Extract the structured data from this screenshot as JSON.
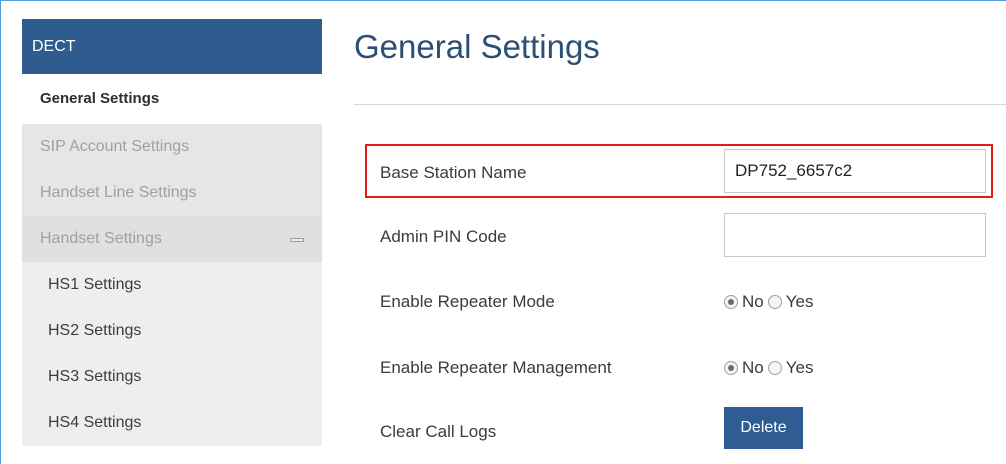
{
  "sidebar": {
    "header": "DECT",
    "active_item": "General Settings",
    "items": [
      {
        "label": "SIP Account Settings"
      },
      {
        "label": "Handset Line Settings"
      },
      {
        "label": "Handset Settings"
      }
    ],
    "sub_items": [
      {
        "label": "HS1 Settings"
      },
      {
        "label": "HS2 Settings"
      },
      {
        "label": "HS3 Settings"
      },
      {
        "label": "HS4 Settings"
      }
    ]
  },
  "main": {
    "title": "General Settings",
    "fields": {
      "base_station_name": {
        "label": "Base Station Name",
        "value": "DP752_6657c2"
      },
      "admin_pin": {
        "label": "Admin PIN Code",
        "value": ""
      },
      "repeater_mode": {
        "label": "Enable Repeater Mode",
        "options": [
          "No",
          "Yes"
        ],
        "selected": "No"
      },
      "repeater_management": {
        "label": "Enable Repeater Management",
        "options": [
          "No",
          "Yes"
        ],
        "selected": "No"
      },
      "clear_call_logs": {
        "label": "Clear Call Logs",
        "button": "Delete"
      }
    }
  },
  "colors": {
    "brand": "#2e5c8f",
    "title": "#2c4f75",
    "highlight": "#e21c1c",
    "sidebar_bg": "#e6e6e6"
  }
}
